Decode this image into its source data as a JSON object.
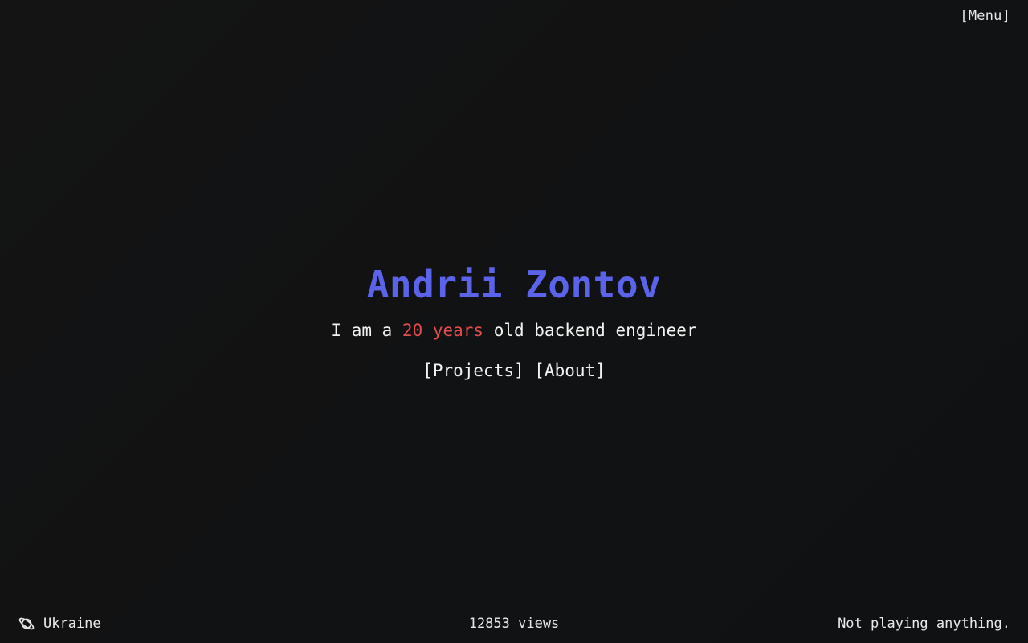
{
  "header": {
    "menu_label": "[Menu]"
  },
  "hero": {
    "name": "Andrii Zontov",
    "tagline_prefix": "I am a ",
    "age_text": "20 years",
    "tagline_suffix": " old backend engineer",
    "links": [
      {
        "label": "[Projects]"
      },
      {
        "label": "[About]"
      }
    ]
  },
  "footer": {
    "location_icon": "planet-icon",
    "location": "Ukraine",
    "views": "12853 views",
    "now_playing": "Not playing anything."
  },
  "colors": {
    "background": "#121314",
    "name_accent": "#5b63ea",
    "age_accent": "#e24c4c",
    "text": "#f2f2f2"
  }
}
